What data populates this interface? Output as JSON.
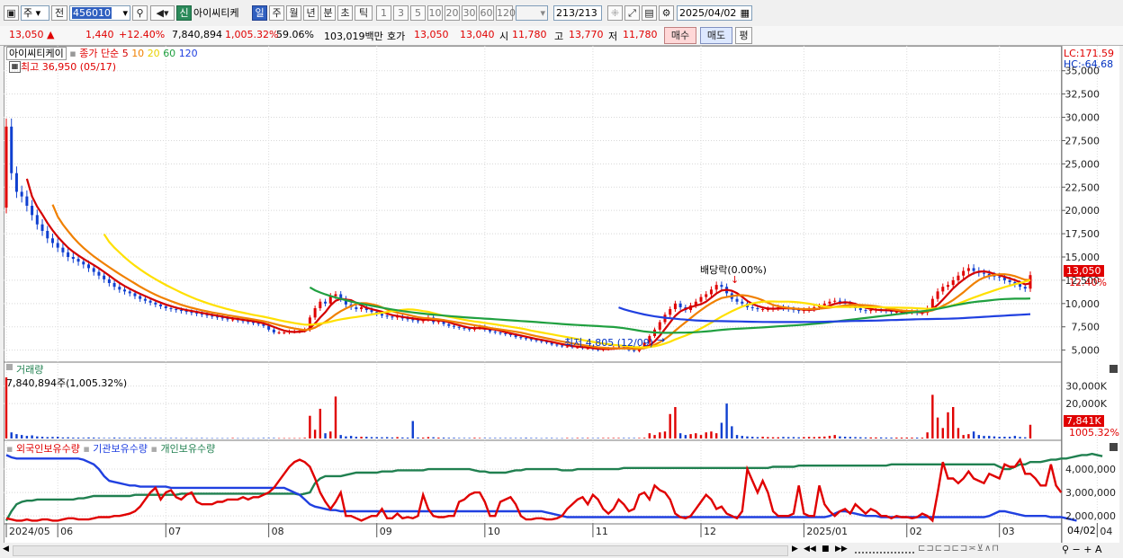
{
  "toolbar": {
    "period_select": "주",
    "prev_button": "전",
    "code_input": "456010",
    "new_badge": "신",
    "stock_name": "아이씨티케",
    "periods": [
      "일",
      "주",
      "월",
      "년",
      "분",
      "초",
      "틱"
    ],
    "active_period": "일",
    "intervals": [
      "1",
      "3",
      "5",
      "10",
      "20",
      "30",
      "60",
      "120"
    ],
    "count_display": "213",
    "count_total": "/213",
    "date_input": "2025/04/02"
  },
  "quote": {
    "price": "13,050",
    "change": "1,440",
    "change_pct": "+12.40%",
    "volume": "7,840,894",
    "volume_ratio": "1,005.32%",
    "turnover": "59.06%",
    "amount": "103,019백만",
    "bid_label": "호가",
    "ask": "13,050",
    "bid": "13,040",
    "open_label": "시",
    "open": "11,780",
    "high_label": "고",
    "high": "13,770",
    "low_label": "저",
    "low": "11,780",
    "buy_button": "매수",
    "sell_button": "매도",
    "eval_button": "평"
  },
  "price_panel": {
    "name_tag": "아이씨티케이",
    "legend_prefix": "종가 단순",
    "ma_periods": [
      "5",
      "10",
      "20",
      "60",
      "120"
    ],
    "ma_colors": [
      "#d40000",
      "#f08000",
      "#ffe000",
      "#20a040",
      "#2040e0"
    ],
    "high_note": "최고 36,950 (05/17)",
    "low_note": "최저 4,805 (12/09)",
    "dividend_note": "배당락(0.00%)",
    "lc": "LC:171.59",
    "hc": "HC:-64.68",
    "last_price_tag": "13,050",
    "last_pct_tag": "12.40%"
  },
  "volume_panel": {
    "title": "거래량",
    "note": "7,840,894주(1,005.32%)",
    "last_tag": "7,841K",
    "last_pct": "1005.32%"
  },
  "holdings_panel": {
    "series": [
      "외국인보유수량",
      "기관보유수량",
      "개인보유수량"
    ],
    "colors": [
      "#e00000",
      "#2040e0",
      "#208050"
    ]
  },
  "x_axis": {
    "labels": [
      "2024/05",
      "06",
      "07",
      "08",
      "09",
      "10",
      "11",
      "12",
      "2025/01",
      "02",
      "03",
      "04"
    ],
    "end_label": "04/02"
  },
  "chart_data": {
    "type": "line",
    "price_ylim": [
      4000,
      37000
    ],
    "price_ticks": [
      "35,000",
      "32,500",
      "30,000",
      "27,500",
      "25,000",
      "22,500",
      "20,000",
      "17,500",
      "15,000",
      "12,500",
      "10,000",
      "7,500",
      "5,000"
    ],
    "volume_ticks": [
      "30,000K",
      "20,000K"
    ],
    "holding_ticks": [
      "4,000,000",
      "3,000,000",
      "2,000,000"
    ],
    "close": [
      29000,
      24000,
      22000,
      21500,
      20500,
      19500,
      18500,
      17800,
      17000,
      16500,
      16000,
      15500,
      15000,
      14800,
      14500,
      14200,
      13800,
      13400,
      13000,
      12600,
      12200,
      11800,
      11500,
      11300,
      11100,
      10800,
      10500,
      10300,
      10100,
      9900,
      9700,
      9500,
      9400,
      9300,
      9200,
      9100,
      9000,
      8900,
      8800,
      8700,
      8600,
      8500,
      8400,
      8300,
      8300,
      8200,
      8100,
      8000,
      7900,
      7800,
      7600,
      7200,
      6900,
      6900,
      6900,
      7000,
      7000,
      7100,
      7200,
      8500,
      9500,
      10200,
      10000,
      10800,
      11000,
      10500,
      9900,
      9600,
      9400,
      9600,
      9300,
      9100,
      8900,
      8700,
      8600,
      8500,
      8600,
      8400,
      8300,
      8200,
      8100,
      8300,
      8500,
      8000,
      8100,
      7800,
      7600,
      7500,
      7400,
      7300,
      7200,
      7400,
      7500,
      7200,
      7000,
      6900,
      6800,
      6700,
      6600,
      6400,
      6300,
      6200,
      6100,
      6000,
      5900,
      5800,
      5600,
      5500,
      5400,
      5400,
      5300,
      5300,
      5200,
      5200,
      5100,
      5000,
      5100,
      5200,
      5300,
      5300,
      5200,
      5000,
      4900,
      5300,
      5800,
      6500,
      7200,
      8000,
      8800,
      9400,
      10000,
      9600,
      9300,
      9800,
      10200,
      10700,
      11000,
      11500,
      12000,
      11800,
      11100,
      10500,
      10200,
      10000,
      9600,
      9500,
      9400,
      9400,
      9400,
      9500,
      9600,
      9500,
      9400,
      9300,
      9200,
      9300,
      9400,
      9600,
      9700,
      10000,
      10200,
      10300,
      10200,
      10000,
      9800,
      9500,
      9300,
      9200,
      9300,
      9400,
      9300,
      9200,
      9100,
      9100,
      9100,
      9100,
      9100,
      9000,
      9000,
      9500,
      10500,
      11300,
      11800,
      12000,
      12500,
      13000,
      13500,
      13800,
      13500,
      13300,
      13200,
      13000,
      12900,
      12800,
      12500,
      12300,
      12100,
      11800,
      11600,
      13050
    ],
    "ma5_start": 4,
    "ma10_start": 9,
    "ma20_start": 19,
    "ma60_start": 59,
    "ma120_start": 119,
    "volume_k": [
      35000,
      3500,
      2500,
      2000,
      1500,
      1800,
      1200,
      1000,
      800,
      900,
      1000,
      600,
      700,
      500,
      500,
      400,
      600,
      500,
      400,
      300,
      300,
      500,
      400,
      300,
      400,
      300,
      300,
      400,
      300,
      300,
      300,
      200,
      300,
      300,
      200,
      300,
      200,
      200,
      300,
      200,
      200,
      200,
      200,
      200,
      300,
      200,
      200,
      200,
      200,
      200,
      300,
      300,
      300,
      200,
      200,
      200,
      200,
      200,
      400,
      13000,
      5000,
      17000,
      3000,
      4000,
      24000,
      2000,
      1200,
      1500,
      1000,
      1000,
      1000,
      800,
      800,
      700,
      800,
      600,
      800,
      600,
      500,
      10000,
      600,
      500,
      800,
      700,
      500,
      500,
      400,
      400,
      300,
      300,
      300,
      400,
      300,
      300,
      300,
      300,
      300,
      300,
      300,
      300,
      300,
      400,
      300,
      300,
      200,
      300,
      300,
      200,
      200,
      300,
      200,
      300,
      300,
      300,
      200,
      300,
      300,
      300,
      300,
      300,
      300,
      300,
      300,
      300,
      400,
      3000,
      2000,
      3500,
      4000,
      14000,
      18000,
      3000,
      2000,
      2500,
      3000,
      2000,
      3500,
      4000,
      3000,
      9000,
      20000,
      7000,
      2000,
      1500,
      1200,
      1000,
      800,
      1000,
      800,
      700,
      700,
      900,
      800,
      800,
      700,
      800,
      900,
      800,
      1000,
      1100,
      1500,
      2000,
      1200,
      1000,
      900,
      800,
      700,
      600,
      600,
      600,
      600,
      500,
      500,
      500,
      500,
      500,
      500,
      500,
      500,
      3500,
      25000,
      12000,
      6000,
      15000,
      18000,
      6000,
      2000,
      2500,
      4000,
      2000,
      1500,
      1500,
      1200,
      1000,
      1000,
      1000,
      1500,
      900,
      700,
      7841
    ],
    "holding_ylim": [
      1700000,
      5000000
    ],
    "foreign": [
      1900000,
      1850000,
      1800000,
      1800000,
      1850000,
      1800000,
      1800000,
      1850000,
      1850000,
      1800000,
      1800000,
      1850000,
      1900000,
      1900000,
      1850000,
      1850000,
      1850000,
      1900000,
      1950000,
      1950000,
      1950000,
      2000000,
      2000000,
      2050000,
      2100000,
      2200000,
      2400000,
      2700000,
      3000000,
      3200000,
      2700000,
      3000000,
      3100000,
      2800000,
      2700000,
      2900000,
      3000000,
      2600000,
      2500000,
      2500000,
      2500000,
      2600000,
      2600000,
      2700000,
      2700000,
      2700000,
      2800000,
      2700000,
      2800000,
      2800000,
      2900000,
      3000000,
      3200000,
      3500000,
      3800000,
      4100000,
      4300000,
      4400000,
      4300000,
      4100000,
      3600000,
      3000000,
      2600000,
      2300000,
      2600000,
      3000000,
      2000000,
      2000000,
      1900000,
      1800000,
      1900000,
      2000000,
      2000000,
      2300000,
      1900000,
      1900000,
      2100000,
      1900000,
      1950000,
      1900000,
      2000000,
      2900000,
      2300000,
      2000000,
      1950000,
      1950000,
      2000000,
      2000000,
      2600000,
      2700000,
      2900000,
      3000000,
      3000000,
      2600000,
      2000000,
      2000000,
      2600000,
      2700000,
      2800000,
      2500000,
      2000000,
      1850000,
      1850000,
      1900000,
      1900000,
      1850000,
      1850000,
      1900000,
      2000000,
      2300000,
      2500000,
      2700000,
      2800000,
      2500000,
      2900000,
      2700000,
      2300000,
      2100000,
      2300000,
      2700000,
      2500000,
      2200000,
      2300000,
      2900000,
      3000000,
      2700000,
      3300000,
      3100000,
      3000000,
      2700000,
      2100000,
      1950000,
      1900000,
      2000000,
      2300000,
      2600000,
      2900000,
      2700000,
      2300000,
      2400000,
      2100000,
      2000000,
      1900000,
      2200000,
      4000000,
      3500000,
      3000000,
      3500000,
      3000000,
      2200000,
      2000000,
      2000000,
      2000000,
      2100000,
      3300000,
      2100000,
      2000000,
      2000000,
      3300000,
      2500000,
      2200000,
      2000000,
      2200000,
      2300000,
      2100000,
      2500000,
      2300000,
      2100000,
      2300000,
      2200000,
      2000000,
      2000000,
      1900000,
      2000000,
      1950000,
      1950000,
      1900000,
      1950000,
      2100000,
      2000000,
      1800000,
      3000000,
      4300000,
      3600000,
      3600000,
      3400000,
      3600000,
      3900000,
      3600000,
      3500000,
      3400000,
      3800000,
      3700000,
      3600000,
      4200000,
      4100000,
      4100000,
      4400000,
      3800000,
      3800000,
      3600000,
      3300000,
      3300000,
      4200000,
      3300000,
      3000000
    ],
    "institution": [
      4600000,
      4500000,
      4450000,
      4450000,
      4450000,
      4450000,
      4450000,
      4450000,
      4450000,
      4450000,
      4450000,
      4450000,
      4450000,
      4450000,
      4450000,
      4400000,
      4300000,
      4200000,
      4000000,
      3700000,
      3500000,
      3450000,
      3400000,
      3350000,
      3300000,
      3300000,
      3250000,
      3250000,
      3250000,
      3250000,
      3250000,
      3250000,
      3200000,
      3200000,
      3200000,
      3200000,
      3200000,
      3200000,
      3200000,
      3200000,
      3200000,
      3200000,
      3200000,
      3200000,
      3200000,
      3200000,
      3200000,
      3200000,
      3200000,
      3200000,
      3200000,
      3200000,
      3200000,
      3200000,
      3200000,
      3100000,
      3000000,
      2900000,
      2700000,
      2500000,
      2400000,
      2350000,
      2300000,
      2250000,
      2250000,
      2200000,
      2200000,
      2200000,
      2200000,
      2200000,
      2200000,
      2200000,
      2200000,
      2200000,
      2200000,
      2200000,
      2200000,
      2200000,
      2200000,
      2200000,
      2200000,
      2200000,
      2200000,
      2200000,
      2200000,
      2200000,
      2200000,
      2200000,
      2200000,
      2200000,
      2200000,
      2200000,
      2200000,
      2200000,
      2200000,
      2200000,
      2200000,
      2200000,
      2200000,
      2200000,
      2200000,
      2200000,
      2200000,
      2200000,
      2200000,
      2150000,
      2100000,
      2050000,
      2000000,
      1950000,
      1950000,
      1950000,
      1950000,
      1950000,
      1950000,
      1950000,
      1950000,
      1950000,
      1950000,
      1950000,
      1950000,
      1950000,
      1950000,
      1950000,
      1950000,
      1950000,
      1950000,
      1950000,
      1950000,
      1950000,
      1950000,
      1950000,
      1950000,
      1950000,
      1950000,
      1950000,
      1950000,
      1950000,
      1950000,
      1950000,
      1950000,
      1950000,
      1950000,
      1950000,
      1950000,
      1950000,
      1950000,
      1950000,
      1950000,
      1950000,
      1950000,
      1950000,
      1950000,
      1950000,
      1950000,
      1950000,
      1950000,
      1950000,
      1950000,
      1950000,
      2000000,
      2100000,
      2200000,
      2200000,
      2150000,
      2100000,
      2050000,
      2000000,
      2000000,
      2000000,
      1950000,
      1950000,
      1950000,
      1950000,
      1950000,
      1950000,
      1950000,
      1950000,
      1950000,
      1950000,
      1950000,
      1950000,
      1950000,
      1950000,
      1950000,
      1950000,
      1950000,
      1950000,
      1950000,
      1950000,
      1950000,
      2000000,
      2100000,
      2200000,
      2200000,
      2150000,
      2100000,
      2050000,
      2000000,
      2000000,
      2000000,
      2000000,
      2000000,
      1950000,
      1950000,
      1950000,
      1900000,
      1850000,
      1800000
    ],
    "individual": [
      1800000,
      2200000,
      2500000,
      2600000,
      2650000,
      2650000,
      2700000,
      2700000,
      2700000,
      2700000,
      2700000,
      2700000,
      2700000,
      2700000,
      2750000,
      2750000,
      2800000,
      2850000,
      2850000,
      2850000,
      2850000,
      2850000,
      2850000,
      2850000,
      2850000,
      2900000,
      2900000,
      2900000,
      2900000,
      2900000,
      2900000,
      2900000,
      2900000,
      2900000,
      2950000,
      2950000,
      2950000,
      2950000,
      2950000,
      2950000,
      2950000,
      2950000,
      2950000,
      2950000,
      2950000,
      2950000,
      2950000,
      2950000,
      2950000,
      2950000,
      2950000,
      2950000,
      2950000,
      2950000,
      2950000,
      2950000,
      2950000,
      2900000,
      2950000,
      3000000,
      3400000,
      3600000,
      3700000,
      3700000,
      3700000,
      3700000,
      3750000,
      3800000,
      3850000,
      3850000,
      3850000,
      3850000,
      3850000,
      3900000,
      3900000,
      3900000,
      3950000,
      3950000,
      3950000,
      3950000,
      3950000,
      3950000,
      4000000,
      4000000,
      4000000,
      4000000,
      4000000,
      4000000,
      4000000,
      4000000,
      4000000,
      3950000,
      3900000,
      3900000,
      3850000,
      3850000,
      3850000,
      3850000,
      3900000,
      3950000,
      3950000,
      4000000,
      4000000,
      4000000,
      4000000,
      4000000,
      4000000,
      4000000,
      3950000,
      3950000,
      3950000,
      4000000,
      4000000,
      4000000,
      4000000,
      4000000,
      4000000,
      4000000,
      4000000,
      4000000,
      4050000,
      4050000,
      4050000,
      4050000,
      4050000,
      4050000,
      4050000,
      4050000,
      4050000,
      4050000,
      4050000,
      4050000,
      4050000,
      4050000,
      4050000,
      4050000,
      4050000,
      4050000,
      4050000,
      4050000,
      4050000,
      4050000,
      4050000,
      4050000,
      4050000,
      4050000,
      4050000,
      4050000,
      4050000,
      4100000,
      4100000,
      4100000,
      4100000,
      4100000,
      4150000,
      4150000,
      4150000,
      4150000,
      4150000,
      4150000,
      4150000,
      4150000,
      4150000,
      4150000,
      4150000,
      4150000,
      4150000,
      4150000,
      4150000,
      4150000,
      4150000,
      4150000,
      4200000,
      4200000,
      4200000,
      4200000,
      4200000,
      4200000,
      4200000,
      4200000,
      4200000,
      4200000,
      4200000,
      4200000,
      4200000,
      4200000,
      4200000,
      4200000,
      4200000,
      4200000,
      4200000,
      4200000,
      4200000,
      4100000,
      4000000,
      4000000,
      4100000,
      4200000,
      4200000,
      4300000,
      4300000,
      4300000,
      4350000,
      4400000,
      4400000,
      4450000,
      4450000,
      4500000,
      4550000,
      4600000,
      4600000,
      4650000,
      4600000,
      4550000
    ]
  }
}
